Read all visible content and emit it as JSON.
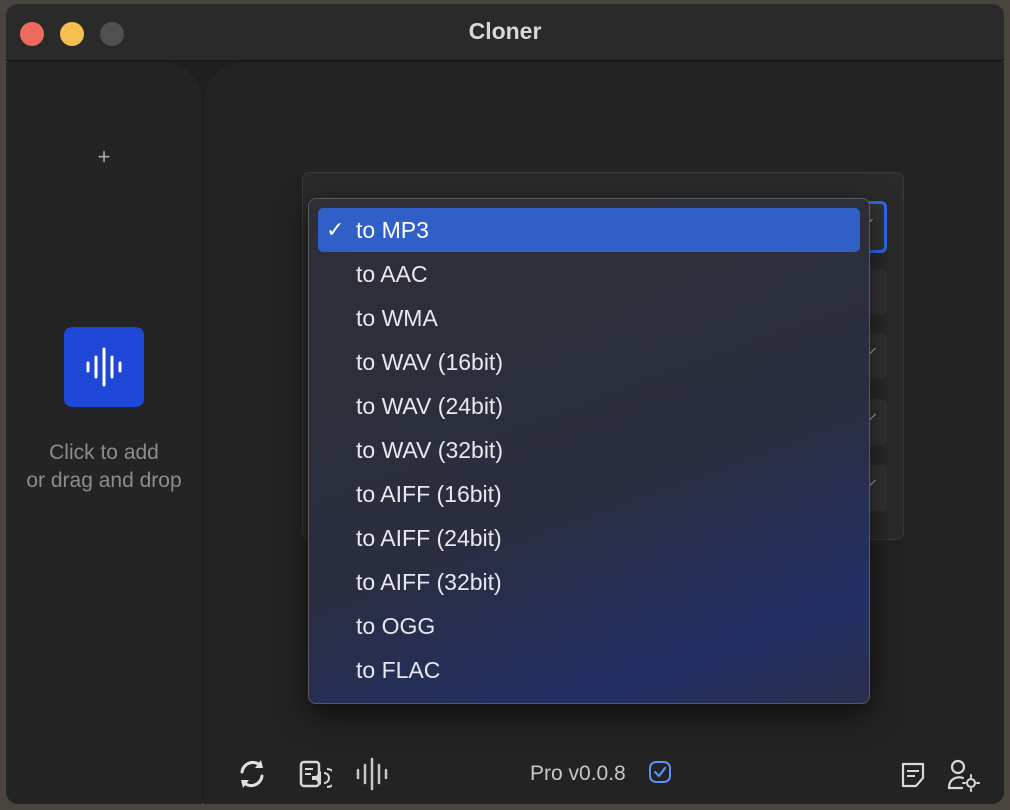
{
  "window": {
    "title": "Cloner"
  },
  "sidebar": {
    "add_symbol": "+",
    "drop_hint_line1": "Click to add",
    "drop_hint_line2": "or drag and drop"
  },
  "format_menu": {
    "selected_index": 0,
    "items": [
      "to MP3",
      "to AAC",
      "to WMA",
      "to WAV (16bit)",
      "to WAV (24bit)",
      "to WAV (32bit)",
      "to AIFF (16bit)",
      "to AIFF (24bit)",
      "to AIFF (32bit)",
      "to OGG",
      "to FLAC"
    ],
    "checkmark": "✓"
  },
  "footer": {
    "version": "Pro v0.0.8"
  },
  "colors": {
    "accent": "#1e47d8",
    "selection": "#2f5fc7",
    "focus_ring": "#2d6bf0"
  },
  "icons": {
    "add": "plus-icon",
    "tile": "waveform-icon",
    "convert": "refresh-icon",
    "speak": "speaker-document-icon",
    "wave": "waveform-icon",
    "verified": "verified-check-icon",
    "notes": "notes-icon",
    "account": "user-settings-icon"
  }
}
